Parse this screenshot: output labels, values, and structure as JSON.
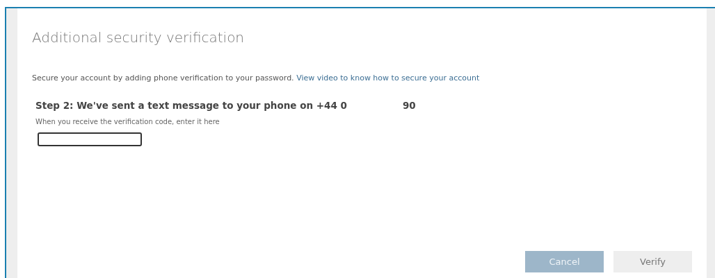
{
  "dialog": {
    "title": "Additional security verification",
    "intro": {
      "text": "Secure your account by adding phone verification to your password.",
      "link": "View video to know how to secure your account"
    },
    "step": {
      "heading": "Step 2: We've sent a text message to your phone on +44 0",
      "number_tail": "90"
    },
    "hint": "When you receive the verification code, enter it here",
    "buttons": [
      {
        "label": "Cancel",
        "kind": "primary"
      },
      {
        "label": "Verify",
        "kind": "default"
      }
    ]
  }
}
